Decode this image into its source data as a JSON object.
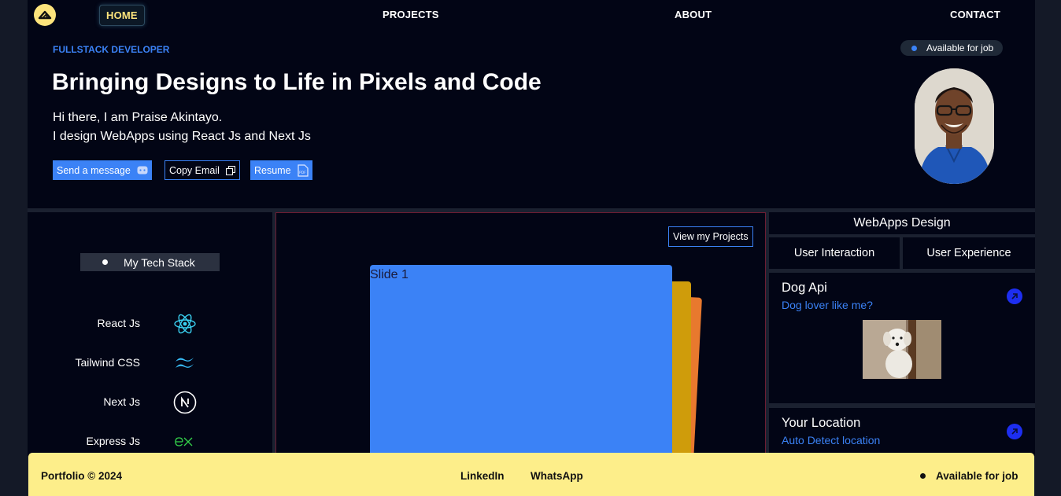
{
  "nav": {
    "home": "HOME",
    "projects": "PROJECTS",
    "about": "ABOUT",
    "contact": "CONTACT"
  },
  "hero": {
    "eyebrow": "FULLSTACK DEVELOPER",
    "headline": "Bringing Designs to Life in Pixels and Code",
    "intro_line1": "Hi there, I am Praise Akintayo.",
    "intro_line2": "I design WebApps using React Js and Next Js",
    "buttons": {
      "message": "Send a message",
      "copy_email": "Copy Email",
      "resume": "Resume"
    },
    "availability": "Available for job"
  },
  "tech": {
    "title": "My Tech Stack",
    "items": [
      "React Js",
      "Tailwind CSS",
      "Next Js",
      "Express Js"
    ]
  },
  "projects": {
    "view_button": "View my Projects",
    "slide_label": "Slide 1"
  },
  "tags": {
    "main": "WebApps Design",
    "left": "User Interaction",
    "right": "User Experience"
  },
  "apis": [
    {
      "title": "Dog Api",
      "link": "Dog lover like me?"
    },
    {
      "title": "Your Location",
      "link": "Auto Detect location"
    }
  ],
  "footer": {
    "copyright": "Portfolio © 2024",
    "linkedin": "LinkedIn",
    "whatsapp": "WhatsApp",
    "availability": "Available for job"
  },
  "colors": {
    "accent": "#3b82f6",
    "brand_yellow": "#fde47c",
    "footer_bg": "#fdee8a",
    "card_bg": "#020515"
  }
}
